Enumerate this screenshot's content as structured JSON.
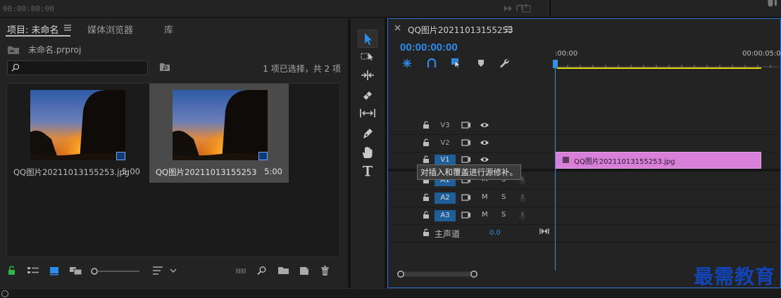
{
  "top": {
    "timecode": "00:00:00:00"
  },
  "project_panel": {
    "tabs": [
      "项目: 未命名",
      "媒体浏览器",
      "库"
    ],
    "project_file": "未命名.prproj",
    "search_placeholder": "",
    "selection_status": "1 项已选择，共 2 项",
    "items": [
      {
        "name": "QQ图片20211013155253.jpg",
        "duration": "5:00",
        "selected": false
      },
      {
        "name": "QQ图片20211013155253",
        "duration": "5:00",
        "selected": true
      }
    ]
  },
  "timeline": {
    "sequence_name": "QQ图片20211013155253",
    "timecode": "00:00:00:00",
    "ruler_start": ":00:00",
    "ruler_end": "00:00:05:00",
    "video_tracks": [
      "V3",
      "V2",
      "V1"
    ],
    "audio_tracks": [
      "A1",
      "A2",
      "A3"
    ],
    "audio_letters": {
      "mute": "M",
      "solo": "S"
    },
    "master": {
      "label": "主声道",
      "value": "0.0"
    },
    "clip_label": "QQ图片20211013155253.jpg",
    "tooltip": "对插入和覆盖进行源修补。"
  },
  "watermark": "最需教育",
  "colors": {
    "accent": "#2d8ceb",
    "clip": "#d880d9",
    "track_active": "#1f5f99",
    "work_area": "#e4d500",
    "watermark": "#1244b8"
  }
}
